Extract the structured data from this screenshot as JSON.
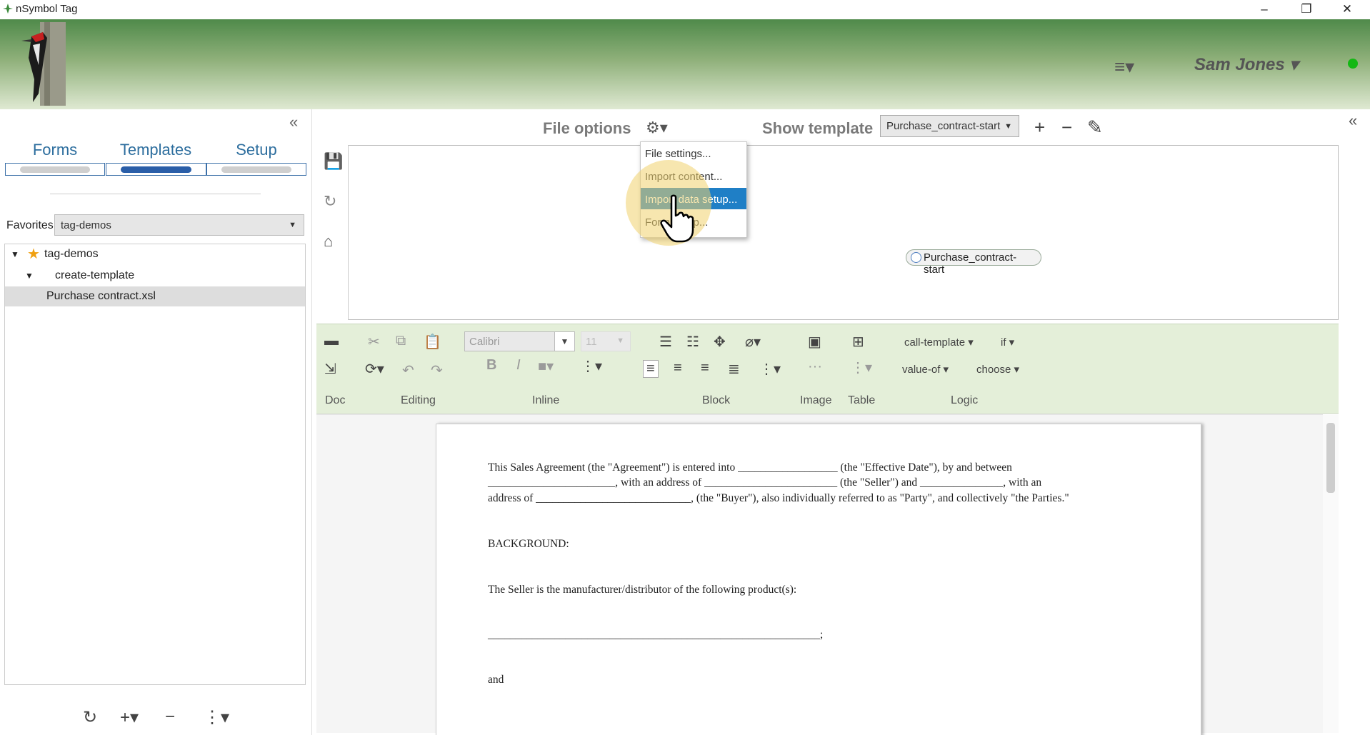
{
  "window": {
    "title": "nSymbol Tag",
    "controls": [
      "–",
      "❐",
      "✕"
    ]
  },
  "header": {
    "menu_icon": "≡▾",
    "user_name": "Sam Jones ▾",
    "status": "online"
  },
  "left_panel": {
    "tabs": [
      {
        "label": "Forms",
        "active": false
      },
      {
        "label": "Templates",
        "active": true
      },
      {
        "label": "Setup",
        "active": false
      }
    ],
    "favorites_label": "Favorites",
    "favorites_value": "tag-demos",
    "tree": [
      {
        "label": "tag-demos",
        "level": 0,
        "expanded": true,
        "starred": true
      },
      {
        "label": "create-template",
        "level": 1,
        "expanded": true
      },
      {
        "label": "Purchase contract.xsl",
        "level": 2,
        "selected": true
      }
    ],
    "bottom_tools": {
      "refresh": "↻",
      "add": "+▾",
      "remove": "−",
      "more": "⋮▾"
    }
  },
  "file_bar": {
    "file_options_label": "File options",
    "show_template_label": "Show template",
    "template_value": "Purchase_contract-start",
    "add": "+",
    "remove": "−",
    "edit": "✎"
  },
  "file_menu": {
    "items": [
      {
        "label": "File settings..."
      },
      {
        "label": "Import content..."
      },
      {
        "label": "Import data setup...",
        "highlighted": true
      },
      {
        "label": "Form setup..."
      }
    ]
  },
  "preview": {
    "radio_label": "Purchase_contract-start"
  },
  "toolbar": {
    "font_name": "Calibri",
    "font_size": "11",
    "groups": {
      "doc": "Doc",
      "editing": "Editing",
      "inline": "Inline",
      "block": "Block",
      "image": "Image",
      "table": "Table",
      "logic": "Logic"
    },
    "logic": {
      "call_template": "call-template ▾",
      "if": "if ▾",
      "value_of": "value-of ▾",
      "choose": "choose ▾"
    }
  },
  "document": {
    "lines": [
      "This Sales Agreement (the \"Agreement\") is entered into __________________ (the \"Effective Date\"), by and between",
      "_______________________, with an address of ________________________ (the \"Seller\") and _______________, with an",
      "address of ____________________________, (the \"Buyer\"), also individually referred to as \"Party\", and collectively \"the Parties.\"",
      "BACKGROUND:",
      "The Seller is the manufacturer/distributor of the following product(s):",
      "____________________________________________________________;",
      "and"
    ]
  },
  "colors": {
    "accent": "#2a5ea8",
    "highlight": "#1f7fc6",
    "toolbar_bg": "#e4efd9",
    "status": "#14b814"
  }
}
